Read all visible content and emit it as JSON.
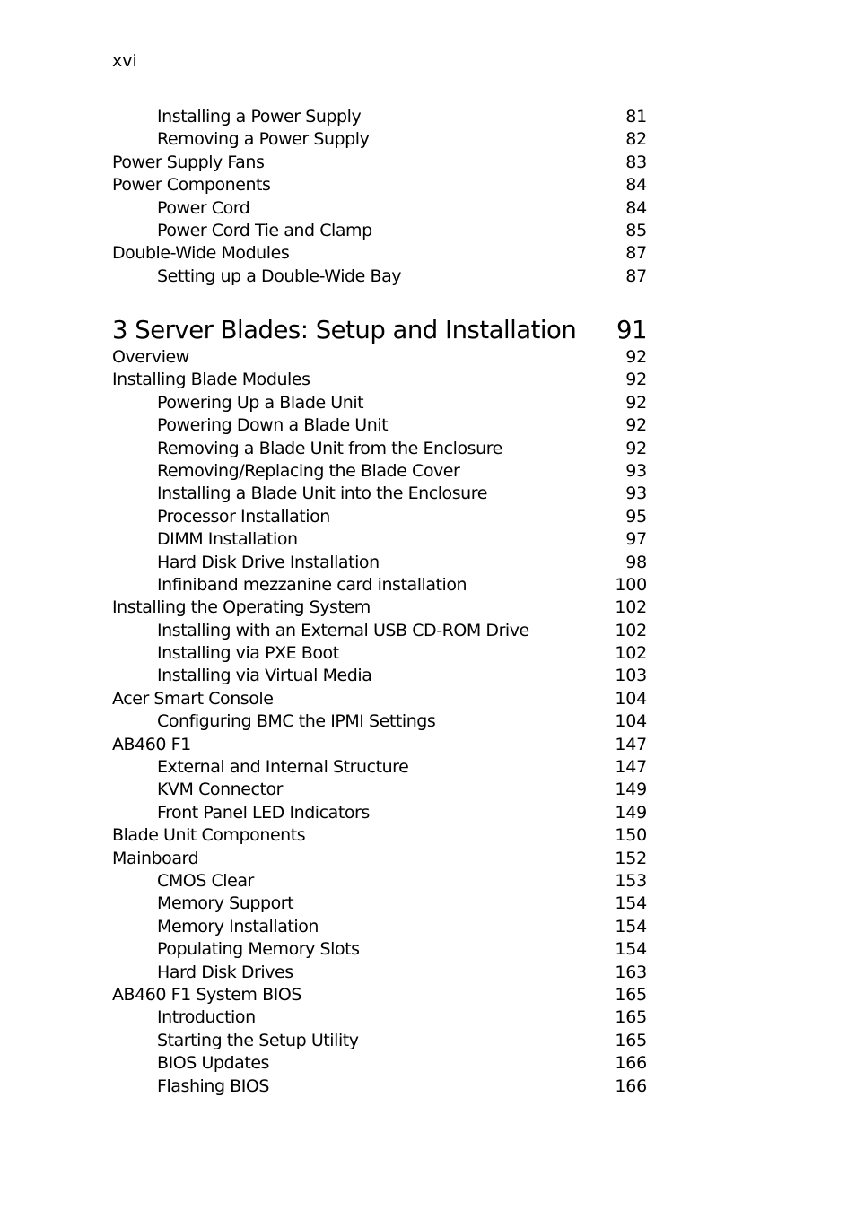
{
  "page": {
    "number": "xvi"
  },
  "toc_continued": [
    {
      "level": 2,
      "title": "Installing a Power Supply",
      "page": "81"
    },
    {
      "level": 2,
      "title": "Removing a Power Supply",
      "page": "82"
    },
    {
      "level": 1,
      "title": "Power Supply Fans",
      "page": "83"
    },
    {
      "level": 1,
      "title": "Power Components",
      "page": "84"
    },
    {
      "level": 2,
      "title": "Power Cord",
      "page": "84"
    },
    {
      "level": 2,
      "title": "Power Cord Tie and Clamp",
      "page": "85"
    },
    {
      "level": 1,
      "title": "Double-Wide Modules",
      "page": "87"
    },
    {
      "level": 2,
      "title": "Setting up a Double-Wide Bay",
      "page": "87"
    }
  ],
  "chapter": {
    "title": "3 Server Blades: Setup and Installation",
    "page": "91",
    "entries": [
      {
        "level": 1,
        "title": "Overview",
        "page": "92"
      },
      {
        "level": 1,
        "title": "Installing Blade Modules",
        "page": "92"
      },
      {
        "level": 2,
        "title": "Powering Up a Blade Unit",
        "page": "92"
      },
      {
        "level": 2,
        "title": "Powering Down a Blade Unit",
        "page": "92"
      },
      {
        "level": 2,
        "title": "Removing a Blade Unit from the Enclosure",
        "page": "92"
      },
      {
        "level": 2,
        "title": "Removing/Replacing the Blade Cover",
        "page": "93"
      },
      {
        "level": 2,
        "title": "Installing a Blade Unit into the Enclosure",
        "page": "93"
      },
      {
        "level": 2,
        "title": "Processor Installation",
        "page": "95"
      },
      {
        "level": 2,
        "title": "DIMM Installation",
        "page": "97"
      },
      {
        "level": 2,
        "title": "Hard Disk Drive Installation",
        "page": "98"
      },
      {
        "level": 2,
        "title": "Infiniband mezzanine card installation",
        "page": "100"
      },
      {
        "level": 1,
        "title": "Installing the Operating System",
        "page": "102"
      },
      {
        "level": 2,
        "title": "Installing with an External USB CD-ROM Drive",
        "page": "102"
      },
      {
        "level": 2,
        "title": "Installing via PXE Boot",
        "page": "102"
      },
      {
        "level": 2,
        "title": "Installing via Virtual Media",
        "page": "103"
      },
      {
        "level": 1,
        "title": "Acer Smart Console",
        "page": "104"
      },
      {
        "level": 2,
        "title": "Configuring BMC the IPMI Settings",
        "page": "104"
      },
      {
        "level": 1,
        "title": "AB460 F1",
        "page": "147"
      },
      {
        "level": 2,
        "title": "External and Internal Structure",
        "page": "147"
      },
      {
        "level": 2,
        "title": "KVM Connector",
        "page": "149"
      },
      {
        "level": 2,
        "title": "Front Panel LED Indicators",
        "page": "149"
      },
      {
        "level": 1,
        "title": "Blade Unit Components",
        "page": "150"
      },
      {
        "level": 1,
        "title": "Mainboard",
        "page": "152"
      },
      {
        "level": 2,
        "title": "CMOS Clear",
        "page": "153"
      },
      {
        "level": 2,
        "title": "Memory Support",
        "page": "154"
      },
      {
        "level": 2,
        "title": "Memory Installation",
        "page": "154"
      },
      {
        "level": 2,
        "title": "Populating Memory Slots",
        "page": "154"
      },
      {
        "level": 2,
        "title": "Hard Disk Drives",
        "page": "163"
      },
      {
        "level": 1,
        "title": "AB460 F1 System BIOS",
        "page": "165"
      },
      {
        "level": 2,
        "title": "Introduction",
        "page": "165"
      },
      {
        "level": 2,
        "title": "Starting the Setup Utility",
        "page": "165"
      },
      {
        "level": 2,
        "title": "BIOS Updates",
        "page": "166"
      },
      {
        "level": 2,
        "title": "Flashing BIOS",
        "page": "166"
      }
    ]
  }
}
